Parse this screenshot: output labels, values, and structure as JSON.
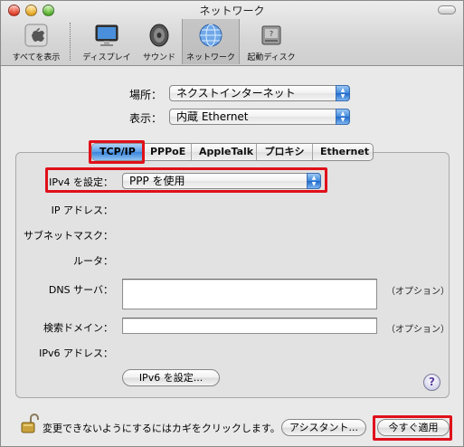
{
  "window": {
    "title": "ネットワーク"
  },
  "toolbar": {
    "items": [
      {
        "label": "すべてを表示",
        "icon": "apple-logo-icon"
      },
      {
        "label": "ディスプレイ",
        "icon": "display-icon"
      },
      {
        "label": "サウンド",
        "icon": "speaker-icon"
      },
      {
        "label": "ネットワーク",
        "icon": "globe-network-icon",
        "selected": true
      },
      {
        "label": "起動ディスク",
        "icon": "startup-disk-icon"
      }
    ]
  },
  "location": {
    "label": "場所：",
    "value": "ネクストインターネット"
  },
  "show": {
    "label": "表示：",
    "value": "内蔵 Ethernet"
  },
  "tabs": [
    {
      "label": "TCP/IP",
      "active": true
    },
    {
      "label": "PPPoE"
    },
    {
      "label": "AppleTalk"
    },
    {
      "label": "プロキシ"
    },
    {
      "label": "Ethernet"
    }
  ],
  "ipv4": {
    "label": "IPv4 を設定：",
    "value": "PPP を使用"
  },
  "fields": {
    "ip_address": "IP アドレス：",
    "subnet_mask": "サブネットマスク：",
    "router": "ルータ：",
    "dns_server": "DNS サーバ：",
    "search_domain": "検索ドメイン：",
    "ipv6_address": "IPv6 アドレス：",
    "option": "（オプション）"
  },
  "buttons": {
    "configure_ipv6": "IPv6 を設定...",
    "help": "?",
    "assistant": "アシスタント...",
    "apply_now": "今すぐ適用"
  },
  "lock_text": "変更できないようにするにはカギをクリックします。",
  "colors": {
    "highlight_red": "#e0101a",
    "aqua_blue": "#3a84db"
  }
}
